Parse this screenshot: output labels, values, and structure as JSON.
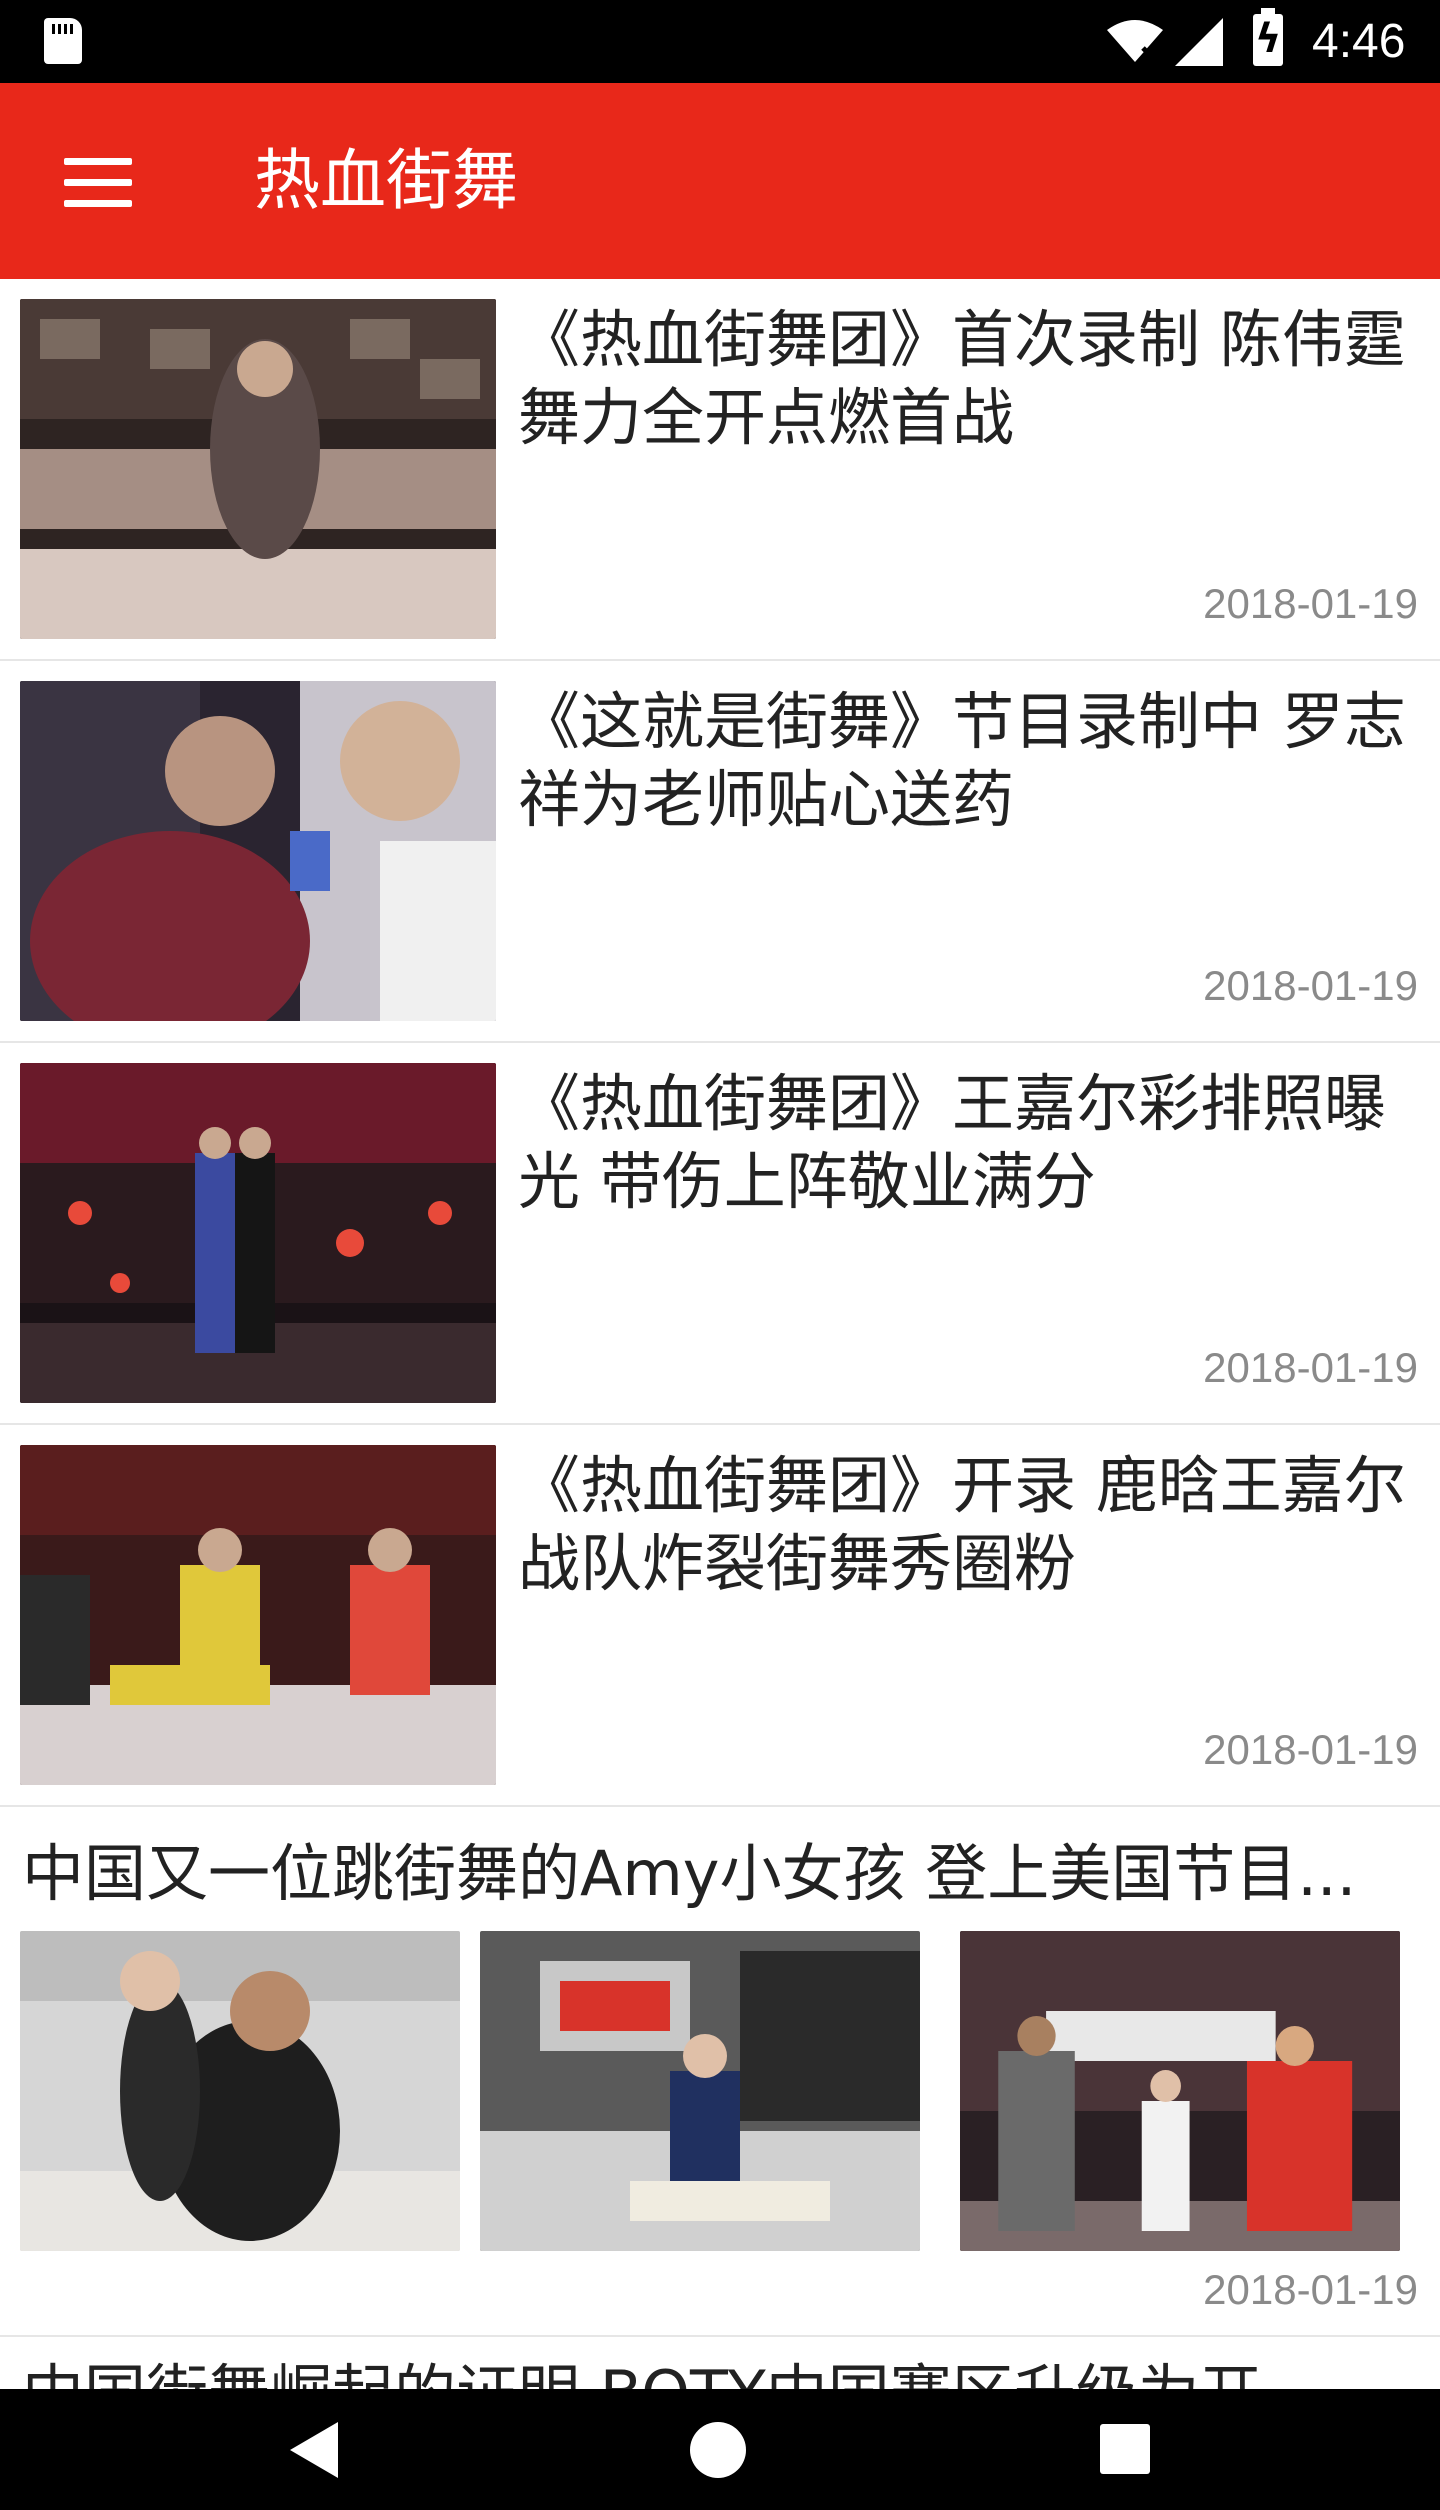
{
  "status_bar": {
    "time": "4:46",
    "icons": [
      "sd-card-icon",
      "wifi-icon",
      "signal-icon",
      "battery-charging-icon"
    ]
  },
  "app_bar": {
    "title": "热血街舞",
    "menu_icon": "menu-icon",
    "background": "#e8281a"
  },
  "news": [
    {
      "title": "《热血街舞团》首次录制 陈伟霆舞力全开点燃首战",
      "date": "2018-01-19",
      "thumb_colors": [
        "#3a2d2a",
        "#8c7467",
        "#d9c8c0"
      ]
    },
    {
      "title": "《这就是街舞》节目录制中 罗志祥为老师贴心送药",
      "date": "2018-01-19",
      "thumb_colors": [
        "#2a2228",
        "#6e2b3a",
        "#c9c4c8"
      ]
    },
    {
      "title": "《热血街舞团》王嘉尔彩排照曝光 带伤上阵敬业满分",
      "date": "2018-01-19",
      "thumb_colors": [
        "#1a1216",
        "#7a1f2a",
        "#3b4a8a"
      ]
    },
    {
      "title": "《热血街舞团》开录 鹿晗王嘉尔战队炸裂街舞秀圈粉",
      "date": "2018-01-19",
      "thumb_colors": [
        "#3a1a1a",
        "#d8c23a",
        "#d9433a"
      ]
    }
  ],
  "multi_item": {
    "title": "中国又一位跳街舞的Amy小女孩 登上美国节目...",
    "date": "2018-01-19",
    "thumbs": [
      {
        "colors": [
          "#cfcfcf",
          "#2a2a2a",
          "#e8e4e0"
        ]
      },
      {
        "colors": [
          "#4a4a4a",
          "#c8d2e0",
          "#d8332a"
        ]
      },
      {
        "colors": [
          "#2a2024",
          "#c24a3a",
          "#8a8a8a"
        ]
      }
    ]
  },
  "partial_item": {
    "title": "中国街舞崛起的证明 BOTY中国赛区升级为开..."
  },
  "nav_bar": {
    "icons": [
      "back-icon",
      "home-icon",
      "recent-apps-icon"
    ]
  }
}
